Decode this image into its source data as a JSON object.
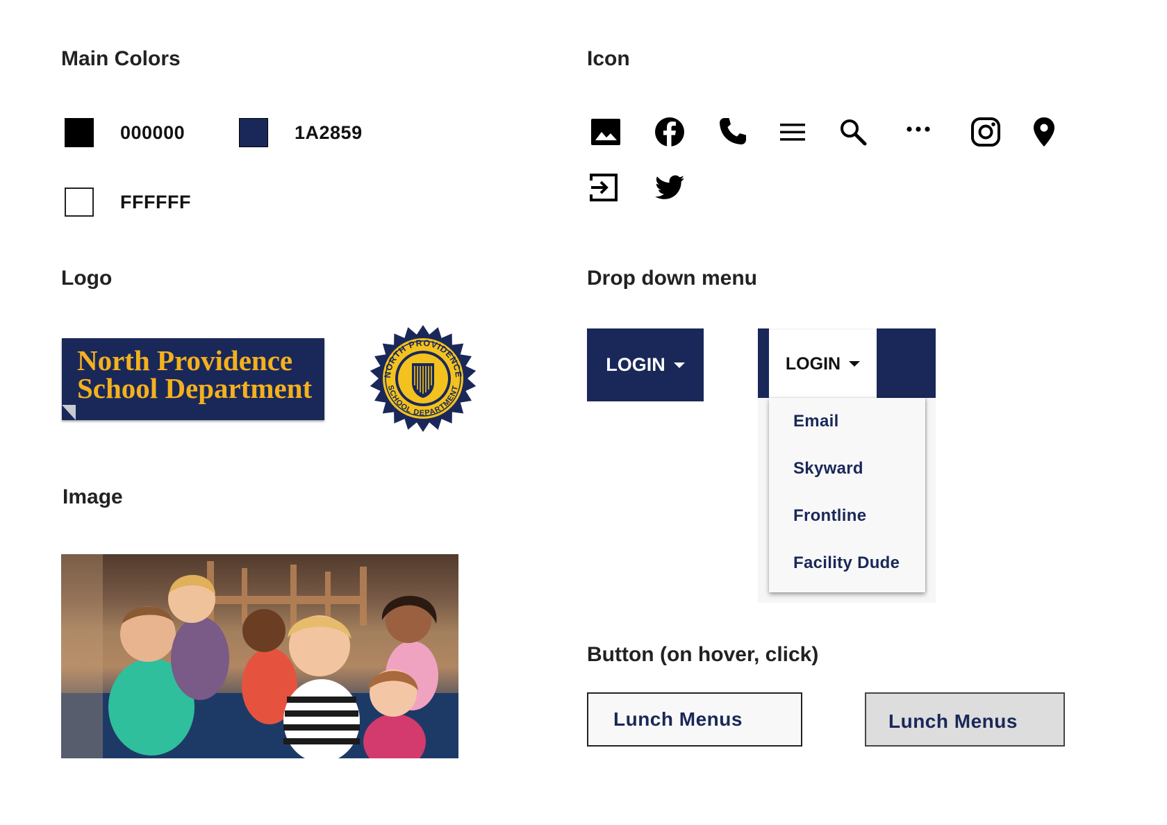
{
  "sections": {
    "main_colors": "Main Colors",
    "icon": "Icon",
    "logo": "Logo",
    "drop_down_menu": "Drop down menu",
    "image": "Image",
    "button": "Button (on hover, click)"
  },
  "colors": [
    {
      "label": "000000",
      "hex": "#000000"
    },
    {
      "label": "1A2859",
      "hex": "#1A2859"
    },
    {
      "label": "FFFFFF",
      "hex": "#FFFFFF"
    }
  ],
  "icons": [
    "image-icon",
    "facebook-icon",
    "phone-icon",
    "menu-icon",
    "search-icon",
    "more-horizontal-icon",
    "instagram-icon",
    "location-pin-icon",
    "login-icon",
    "twitter-icon"
  ],
  "logo": {
    "line1": "North Providence",
    "line2": "School Department",
    "seal_text_top": "NORTH PROVIDENCE",
    "seal_text_bottom": "SCHOOL DEPARTMENT",
    "accent": "#F3B11E"
  },
  "dropdown": {
    "login_label": "LOGIN",
    "items": [
      "Email",
      "Skyward",
      "Frontline",
      "Facility Dude"
    ]
  },
  "buttons": {
    "default_label": "Lunch Menus",
    "hover_label": "Lunch Menus",
    "default_bg": "#F8F8F8",
    "hover_bg": "#DDDDDD"
  },
  "theme": {
    "primary": "#1A2859",
    "text": "#111111",
    "background": "#FFFFFF"
  }
}
